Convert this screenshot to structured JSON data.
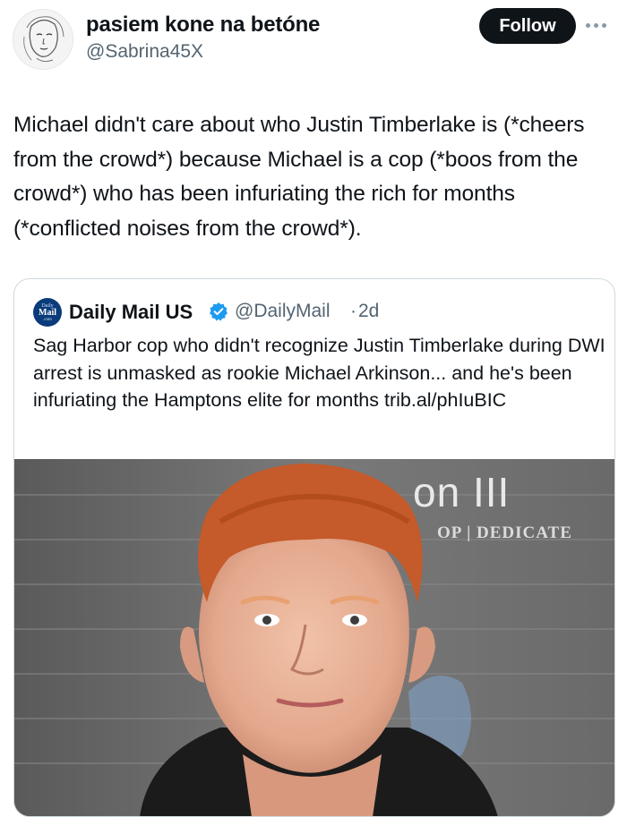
{
  "post": {
    "display_name": "pasiem kone na betóne",
    "handle": "@Sabrina45X",
    "follow_label": "Follow",
    "more_icon": "more-horizontal-icon",
    "text": "Michael didn't care about who Justin Timberlake is (*cheers from the crowd*) because Michael is a cop (*boos from the crowd*) who has been infuriating the rich for months (*conflicted noises from the crowd*)."
  },
  "quote": {
    "logo_lines": [
      "Daily",
      "Mail",
      ".com"
    ],
    "display_name": "Daily Mail US",
    "verified_icon": "verified-badge-icon",
    "handle": "@DailyMail",
    "separator": "·",
    "time": "2d",
    "text": "Sag Harbor cop who didn't recognize Justin Timberlake during DWI arrest is unmasked as rookie Michael Arkinson... and he's been infuriating the Hamptons elite for months trib.al/phIuBIC",
    "photo": {
      "backdrop_text_1": "on III",
      "backdrop_text_2": "OP | DEDICATE"
    }
  },
  "colors": {
    "text": "#0f1419",
    "secondary": "#536471",
    "follow_bg": "#0f1419",
    "verified": "#1d9bf0",
    "border": "#cfd9de"
  }
}
